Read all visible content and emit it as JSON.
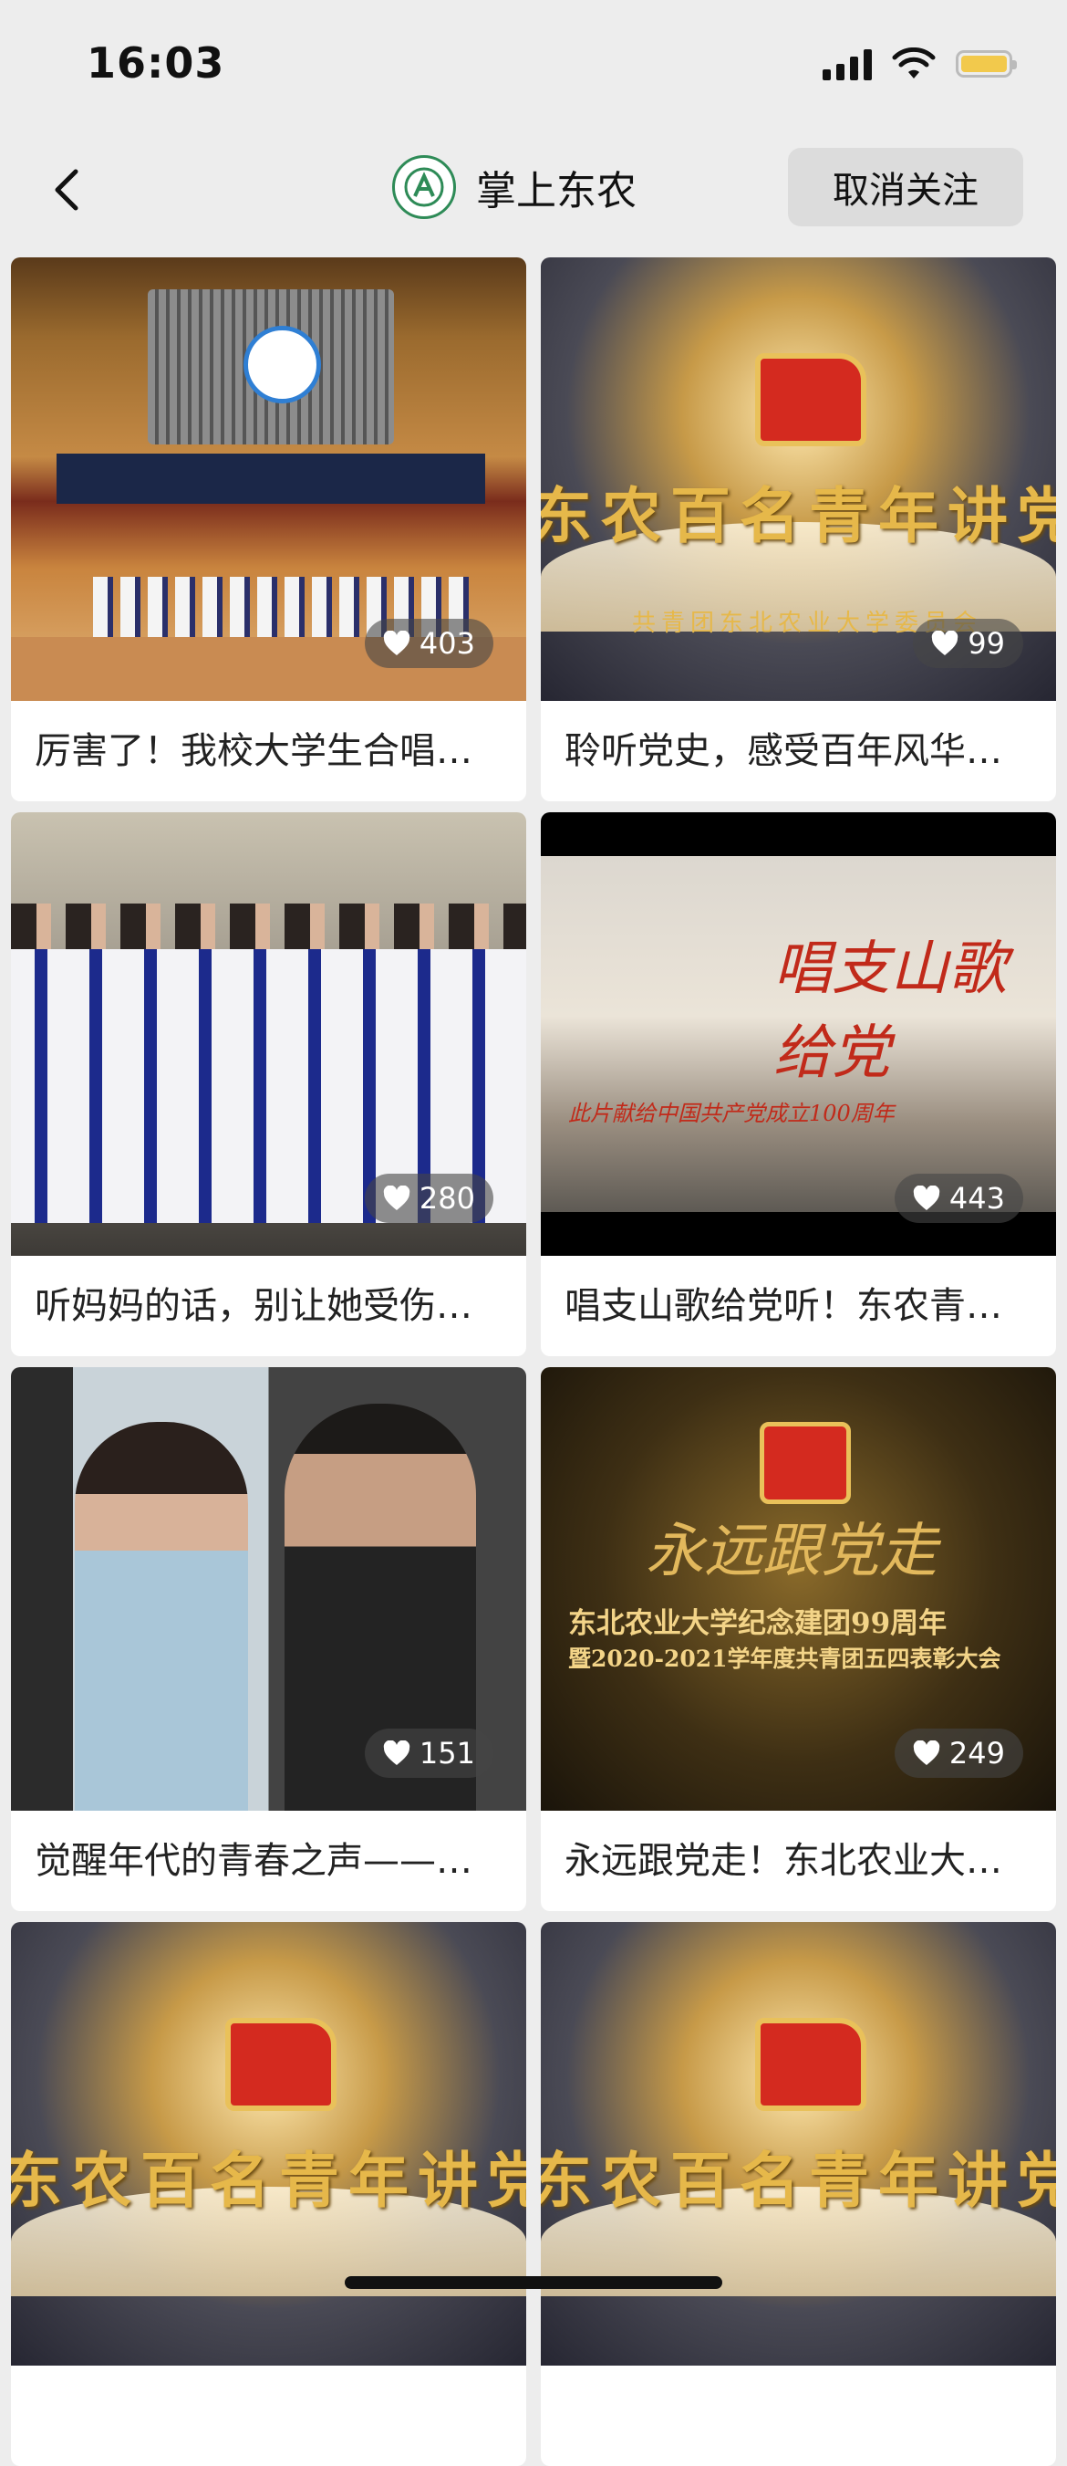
{
  "status_bar": {
    "time": "16:03"
  },
  "nav": {
    "title": "掌上东农",
    "unfollow_label": "取消关注"
  },
  "thumbnail_text": {
    "party_banner": "东农百名青年讲党史",
    "party_banner_sub": "共青团东北农业大学委员会",
    "song_title": "唱支山歌给党",
    "song_sub": "此片献给中国共产党成立100周年",
    "gold_script": "永远跟党走",
    "gold_line1": "东北农业大学纪念建团99周年",
    "gold_line2": "暨2020-2021学年度共青团五四表彰大会"
  },
  "videos": [
    {
      "title": "厉害了！我校大学生合唱团…",
      "likes": "403",
      "thumb": "hall"
    },
    {
      "title": "聆听党史，感受百年风华…",
      "likes": "99",
      "thumb": "clouds"
    },
    {
      "title": "听妈妈的话，别让她受伤…",
      "likes": "280",
      "thumb": "choir"
    },
    {
      "title": "唱支山歌给党听！东农青…",
      "likes": "443",
      "thumb": "song"
    },
    {
      "title": "觉醒年代的青春之声——…",
      "likes": "151",
      "thumb": "actors"
    },
    {
      "title": "永远跟党走！东北农业大…",
      "likes": "249",
      "thumb": "gold"
    },
    {
      "title": "",
      "likes": "",
      "thumb": "clouds"
    },
    {
      "title": "",
      "likes": "",
      "thumb": "clouds"
    }
  ]
}
